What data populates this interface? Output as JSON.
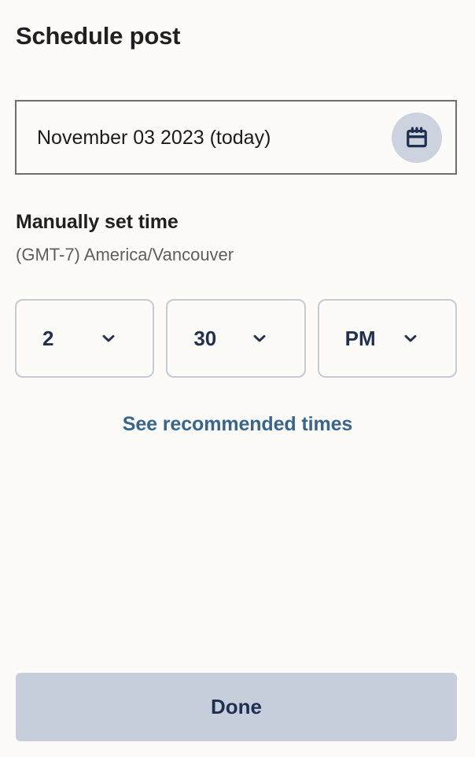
{
  "page": {
    "title": "Schedule post",
    "background_color": "#fcfbf8"
  },
  "date_field": {
    "value": "November 03 2023 (today)",
    "icon": "calendar-icon",
    "icon_badge_color": "#ccd3de",
    "icon_color": "#1f3050",
    "border_color": "#6e6e6e"
  },
  "manual_time": {
    "heading": "Manually set time",
    "timezone": "(GMT-7) America/Vancouver",
    "selects": [
      {
        "name": "hour",
        "value": "2",
        "icon": "chevron-down-icon"
      },
      {
        "name": "minute",
        "value": "30",
        "icon": "chevron-down-icon"
      },
      {
        "name": "meridiem",
        "value": "PM",
        "icon": "chevron-down-icon"
      }
    ],
    "select_text_color": "#1f3050",
    "select_border_color": "#c6cad4"
  },
  "recommended": {
    "label": "See recommended times",
    "color": "#36658d"
  },
  "footer": {
    "done_label": "Done",
    "done_bg_color": "#c7cedb",
    "done_text_color": "#1f3050"
  }
}
